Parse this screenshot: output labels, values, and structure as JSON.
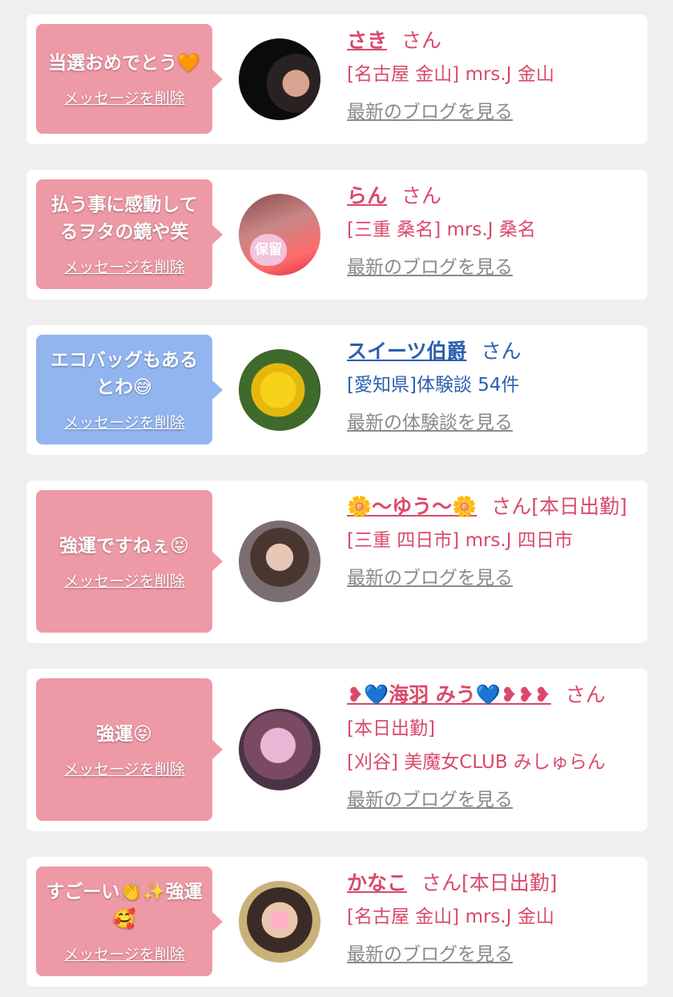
{
  "items": [
    {
      "message": "当選おめでとう🧡",
      "delete_label": "メッセージを削除",
      "name": "さき",
      "honorific": "さん",
      "extra": "",
      "shop_line1": "[名古屋 金山] mrs.J 金山",
      "shop_line2": "",
      "link_label": "最新のブログを見る"
    },
    {
      "message": "払う事に感動してるヲタの鏡や笑",
      "delete_label": "メッセージを削除",
      "name": "らん",
      "honorific": "さん",
      "extra": "",
      "shop_line1": "[三重 桑名] mrs.J 桑名",
      "shop_line2": "",
      "link_label": "最新のブログを見る",
      "avatar_badge": "保留"
    },
    {
      "message": "エコバッグもあるとわ😅",
      "delete_label": "メッセージを削除",
      "name": "スイーツ伯爵",
      "honorific": "さん",
      "extra": "",
      "shop_line1": "[愛知県]体験談 54件",
      "shop_line2": "",
      "link_label": "最新の体験談を見る"
    },
    {
      "message": "強運ですねぇ😝",
      "delete_label": "メッセージを削除",
      "name": "🌼〜ゆう〜🌼",
      "honorific": "さん",
      "extra": "[本日出勤]",
      "shop_line1": "[三重 四日市] mrs.J 四日市",
      "shop_line2": "",
      "link_label": "最新のブログを見る"
    },
    {
      "message": "強運😝",
      "delete_label": "メッセージを削除",
      "name": "❥💙海羽 みう💙❥❥❥",
      "honorific": "さん",
      "extra": "[本日出勤]",
      "shop_line1": "[刈谷] 美魔女CLUB みしゅらん",
      "shop_line2": "",
      "link_label": "最新のブログを見る"
    },
    {
      "message": "すごーい👏✨強運🥰",
      "delete_label": "メッセージを削除",
      "name": "かなこ",
      "honorific": "さん",
      "extra": "[本日出勤]",
      "shop_line1": "[名古屋 金山] mrs.J 金山",
      "shop_line2": "",
      "link_label": "最新のブログを見る"
    }
  ],
  "colors": {
    "pink_bubble": "#ee99a6",
    "blue_bubble": "#92b5f0",
    "name_pink": "#d94a6a",
    "name_blue": "#2c5fb0",
    "link_gray": "#8a8a8a"
  }
}
